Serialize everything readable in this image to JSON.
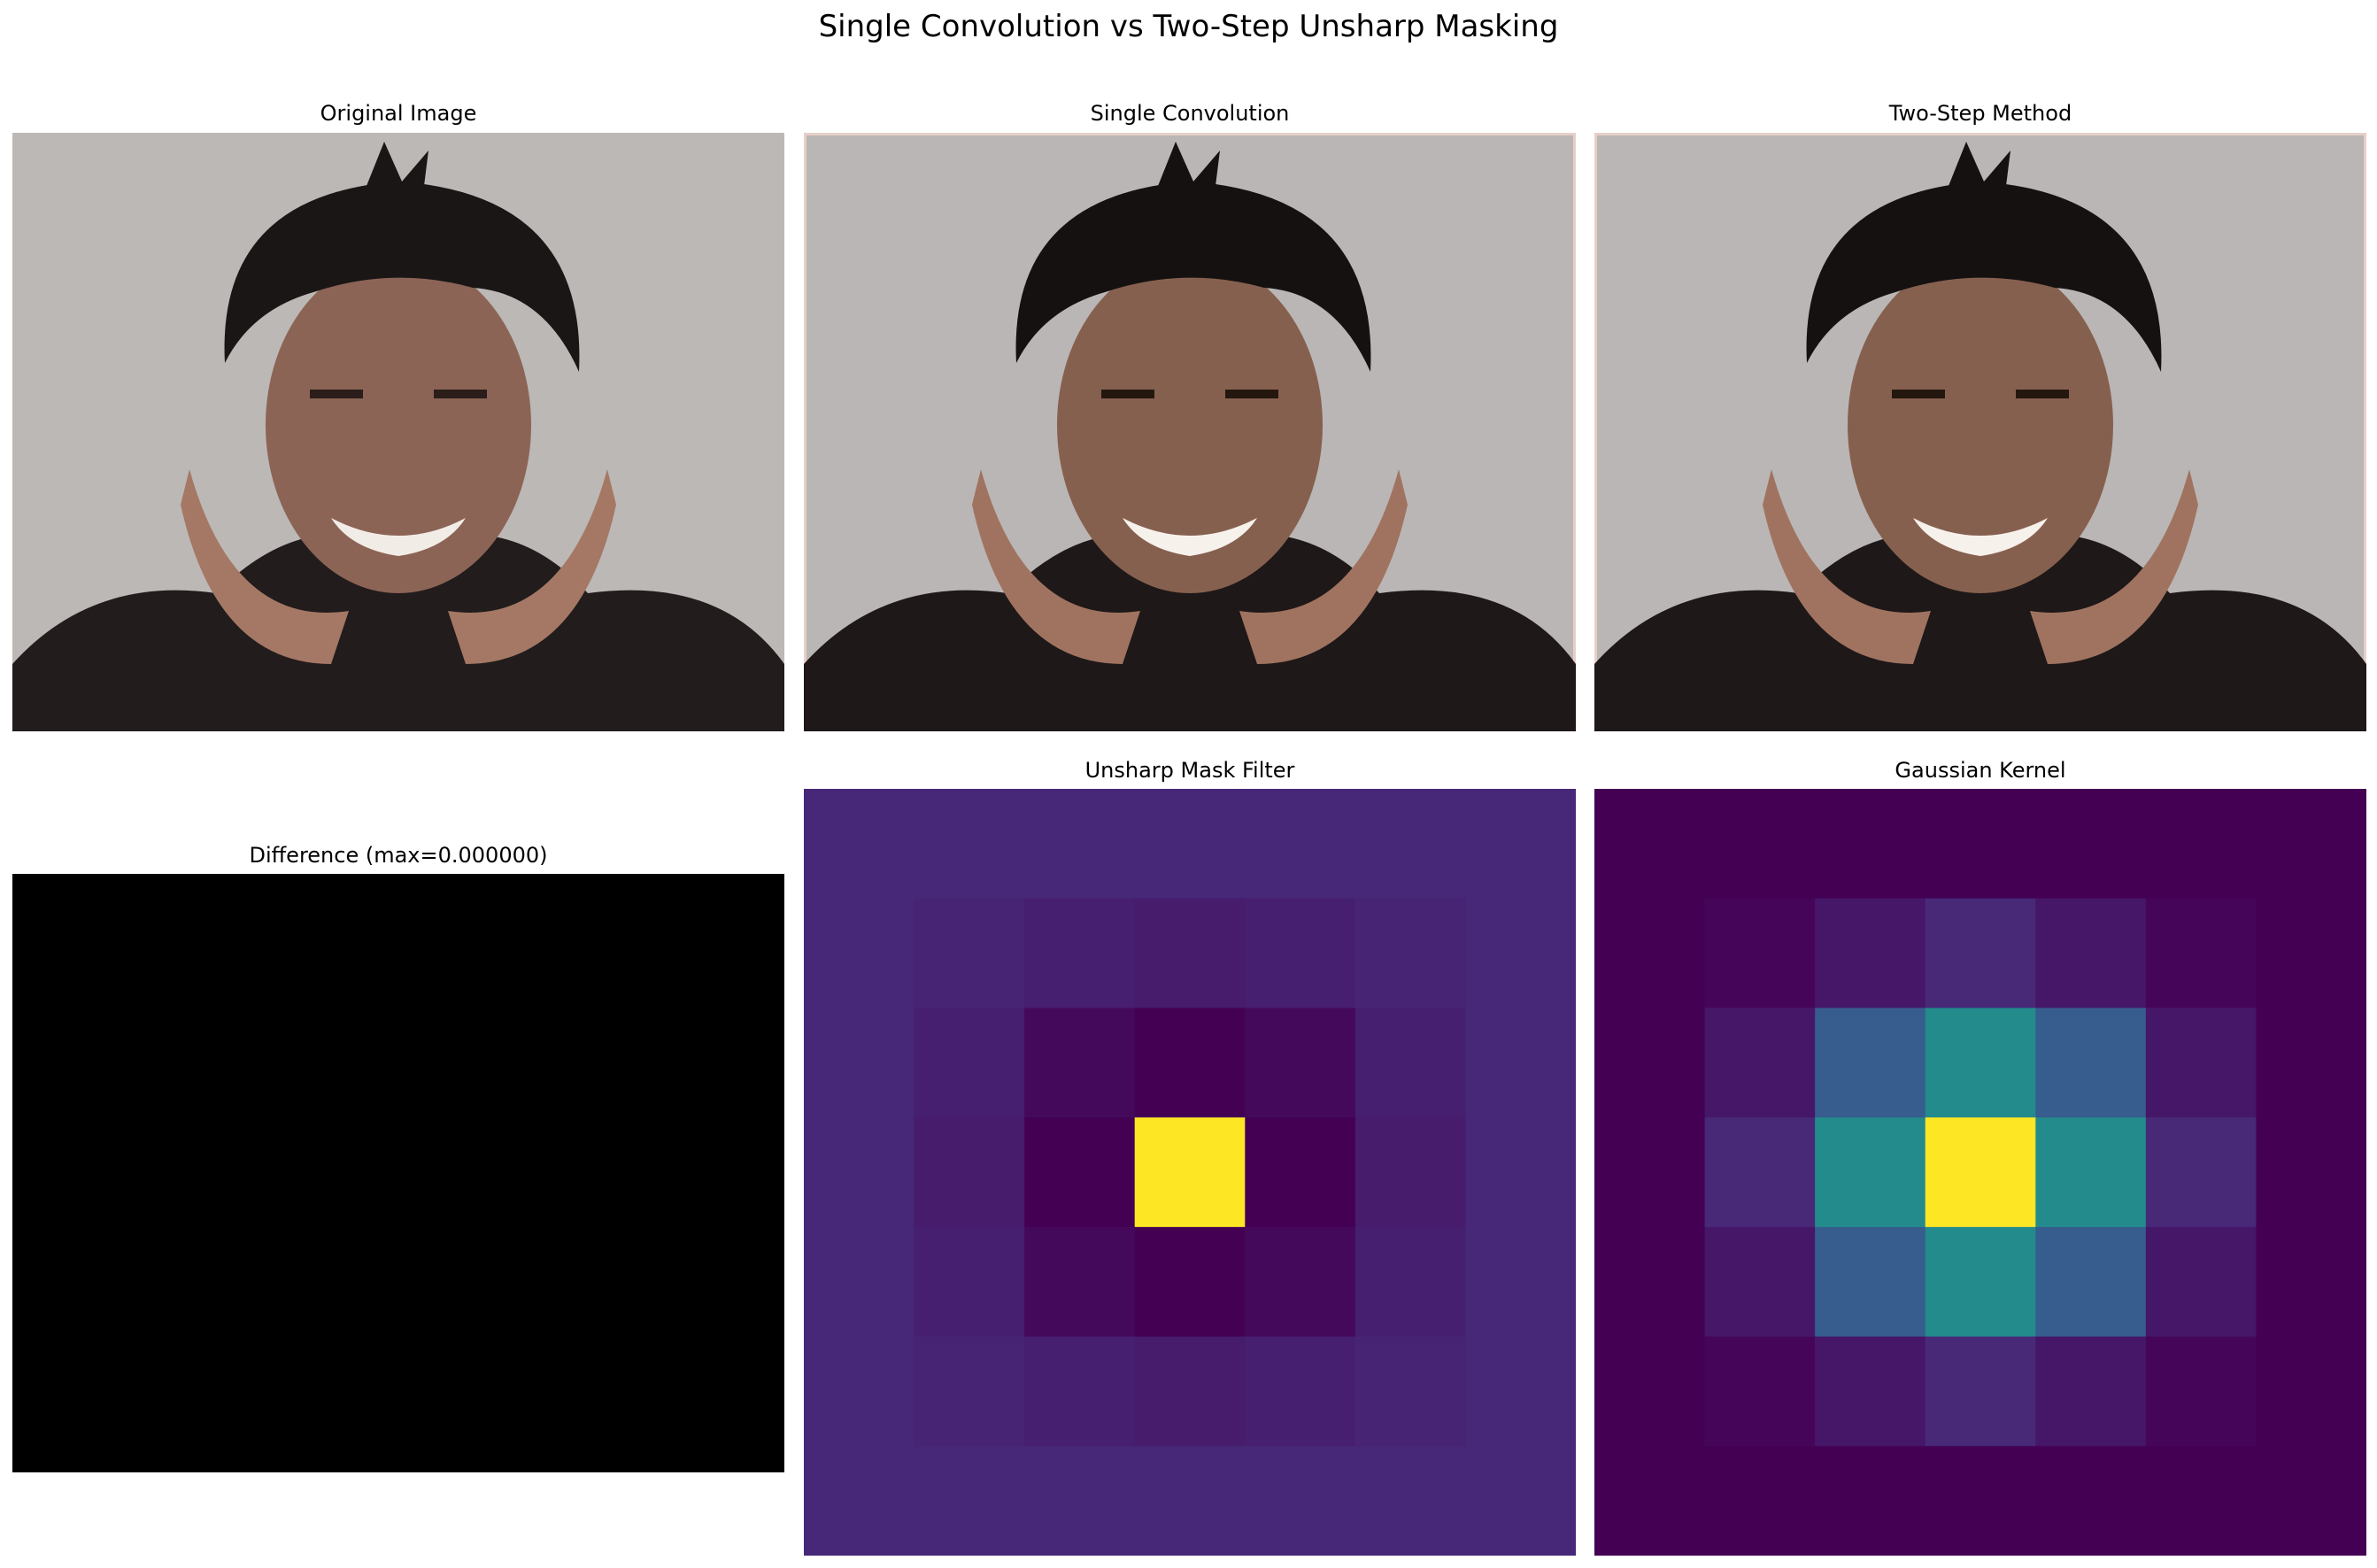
{
  "figure": {
    "title": "Single Convolution vs Two-Step Unsharp Masking"
  },
  "panels": {
    "original": {
      "title": "Original Image"
    },
    "single": {
      "title": "Single Convolution"
    },
    "twostep": {
      "title": "Two-Step Method"
    },
    "difference": {
      "title": "Difference (max=0.000000)"
    },
    "unsharp": {
      "title": "Unsharp Mask Filter"
    },
    "gaussian": {
      "title": "Gaussian Kernel"
    }
  },
  "chart_data": [
    {
      "type": "heatmap",
      "title": "Unsharp Mask Filter",
      "colormap": "viridis",
      "size": 7,
      "values": [
        [
          0.14,
          0.14,
          0.14,
          0.14,
          0.14,
          0.14,
          0.14
        ],
        [
          0.14,
          0.13,
          0.11,
          0.1,
          0.11,
          0.13,
          0.14
        ],
        [
          0.14,
          0.11,
          0.03,
          0.0,
          0.03,
          0.11,
          0.14
        ],
        [
          0.14,
          0.1,
          0.0,
          1.0,
          0.0,
          0.1,
          0.14
        ],
        [
          0.14,
          0.11,
          0.03,
          0.0,
          0.03,
          0.11,
          0.14
        ],
        [
          0.14,
          0.13,
          0.11,
          0.1,
          0.11,
          0.13,
          0.14
        ],
        [
          0.14,
          0.14,
          0.14,
          0.14,
          0.14,
          0.14,
          0.14
        ]
      ]
    },
    {
      "type": "heatmap",
      "title": "Gaussian Kernel",
      "colormap": "viridis",
      "size": 7,
      "values": [
        [
          0.0,
          0.0,
          0.0,
          0.0,
          0.0,
          0.0,
          0.0
        ],
        [
          0.0,
          0.02,
          0.08,
          0.15,
          0.08,
          0.02,
          0.0
        ],
        [
          0.0,
          0.08,
          0.37,
          0.6,
          0.37,
          0.08,
          0.0
        ],
        [
          0.0,
          0.15,
          0.6,
          1.0,
          0.6,
          0.15,
          0.0
        ],
        [
          0.0,
          0.08,
          0.37,
          0.6,
          0.37,
          0.08,
          0.0
        ],
        [
          0.0,
          0.02,
          0.08,
          0.15,
          0.08,
          0.02,
          0.0
        ],
        [
          0.0,
          0.0,
          0.0,
          0.0,
          0.0,
          0.0,
          0.0
        ]
      ]
    },
    {
      "type": "heatmap",
      "title": "Difference (max=0.000000)",
      "colormap": "gray",
      "max": 0.0
    }
  ]
}
